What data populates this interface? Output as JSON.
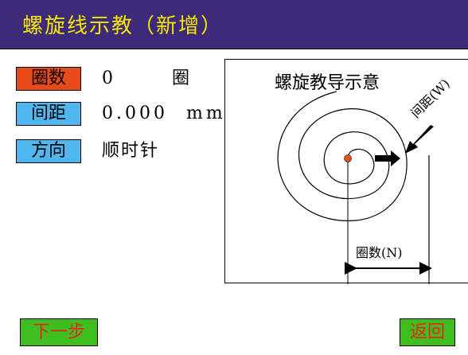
{
  "header": {
    "title": "螺旋线示教（新增）"
  },
  "fields": [
    {
      "label": "圈数",
      "value": "0",
      "unit": "圈",
      "label_color": "#e84a1a"
    },
    {
      "label": "间距",
      "value": "0.000",
      "unit": "mm",
      "label_color": "#4fb6ee"
    },
    {
      "label": "方向",
      "value": "顺时针",
      "unit": "",
      "label_color": "#4fb6ee"
    }
  ],
  "diagram": {
    "title": "螺旋教导示意",
    "pitch_label": "间距(W)",
    "turns_label": "圈数(N)"
  },
  "buttons": {
    "next_label": "下一步",
    "back_label": "返回"
  },
  "colors": {
    "title_bar": "#3d2a78",
    "title_text": "#f5e600",
    "button_bg": "#3fbf1f",
    "button_text": "#e8251a",
    "center_dot": "#e8501a"
  }
}
